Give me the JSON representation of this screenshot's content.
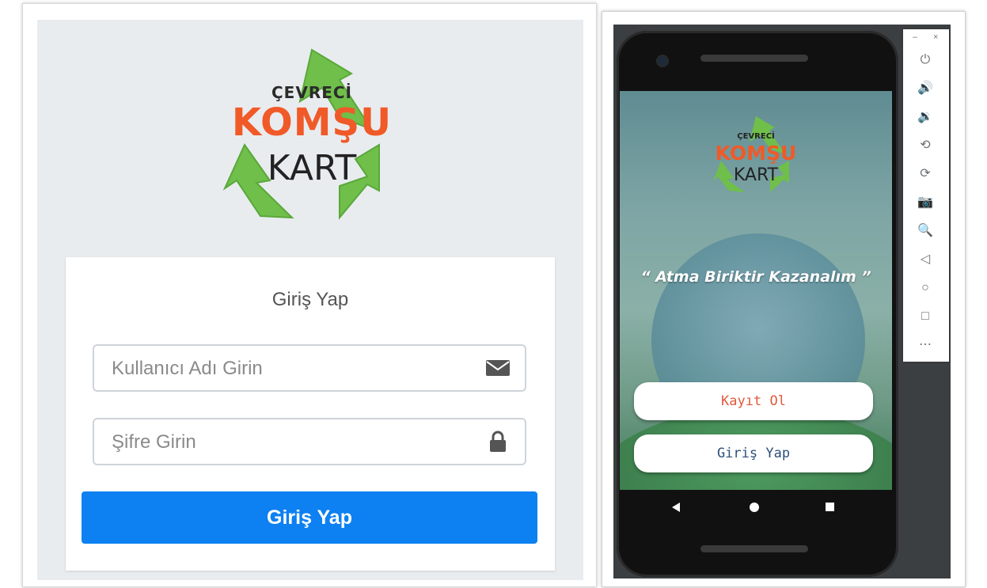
{
  "web_login": {
    "logo": {
      "line1": "ÇEVRECİ",
      "line2": "KOMŞU",
      "line3": "KART"
    },
    "card_title": "Giriş Yap",
    "username_placeholder": "Kullanıcı Adı Girin",
    "password_placeholder": "Şifre Girin",
    "submit_label": "Giriş Yap",
    "accent_color": "#0d80f2"
  },
  "mobile_app": {
    "logo": {
      "line1": "ÇEVRECİ",
      "line2": "KOMŞU",
      "line3": "KART"
    },
    "slogan": "“ Atma Biriktir Kazanalım ”",
    "register_label": "Kayıt Ol",
    "login_label": "Giriş Yap",
    "register_color": "#e0593c",
    "login_color": "#2d4f7a"
  },
  "emulator_toolbar": {
    "minimize": "–",
    "close": "×",
    "buttons": [
      {
        "icon": "power-icon",
        "glyph": "⏻"
      },
      {
        "icon": "volume-up-icon",
        "glyph": "🔊"
      },
      {
        "icon": "volume-down-icon",
        "glyph": "🔉"
      },
      {
        "icon": "rotate-left-icon",
        "glyph": "⟲"
      },
      {
        "icon": "rotate-right-icon",
        "glyph": "⟳"
      },
      {
        "icon": "camera-icon",
        "glyph": "📷"
      },
      {
        "icon": "zoom-icon",
        "glyph": "🔍"
      },
      {
        "icon": "back-icon",
        "glyph": "◁"
      },
      {
        "icon": "home-icon",
        "glyph": "○"
      },
      {
        "icon": "overview-icon",
        "glyph": "□"
      },
      {
        "icon": "more-icon",
        "glyph": "⋯"
      }
    ]
  }
}
